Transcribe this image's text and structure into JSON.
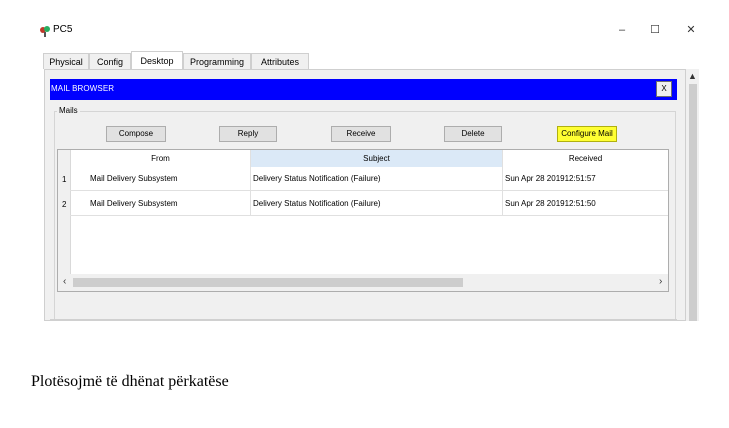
{
  "window": {
    "title": "PC5",
    "controls": {
      "minimize": "–",
      "maximize": "☐",
      "close": "✕"
    }
  },
  "tabs": [
    {
      "label": "Physical"
    },
    {
      "label": "Config"
    },
    {
      "label": "Desktop",
      "active": true
    },
    {
      "label": "Programming"
    },
    {
      "label": "Attributes"
    }
  ],
  "mail_browser": {
    "title": "MAIL BROWSER",
    "close_label": "X",
    "group_label": "Mails",
    "buttons": {
      "compose": "Compose",
      "reply": "Reply",
      "receive": "Receive",
      "delete": "Delete",
      "configure": "Configure Mail"
    },
    "columns": {
      "from": "From",
      "subject": "Subject",
      "received": "Received"
    },
    "rows": [
      {
        "num": "1",
        "from": "Mail Delivery Subsystem",
        "subject": "Delivery Status Notification (Failure)",
        "received": "Sun Apr 28 201912:51:57"
      },
      {
        "num": "2",
        "from": "Mail Delivery Subsystem",
        "subject": "Delivery Status Notification (Failure)",
        "received": "Sun Apr 28 201912:51:50"
      }
    ]
  },
  "caption": "Plotësojmë të dhënat përkatëse",
  "colors": {
    "header": "#0000ff",
    "highlight": "#ffff33",
    "sorted_column": "#dbe9f7"
  },
  "icons": [
    "app-icon",
    "minimize-icon",
    "maximize-icon",
    "close-icon",
    "scroll-up-icon",
    "scroll-left-icon",
    "scroll-right-icon"
  ]
}
